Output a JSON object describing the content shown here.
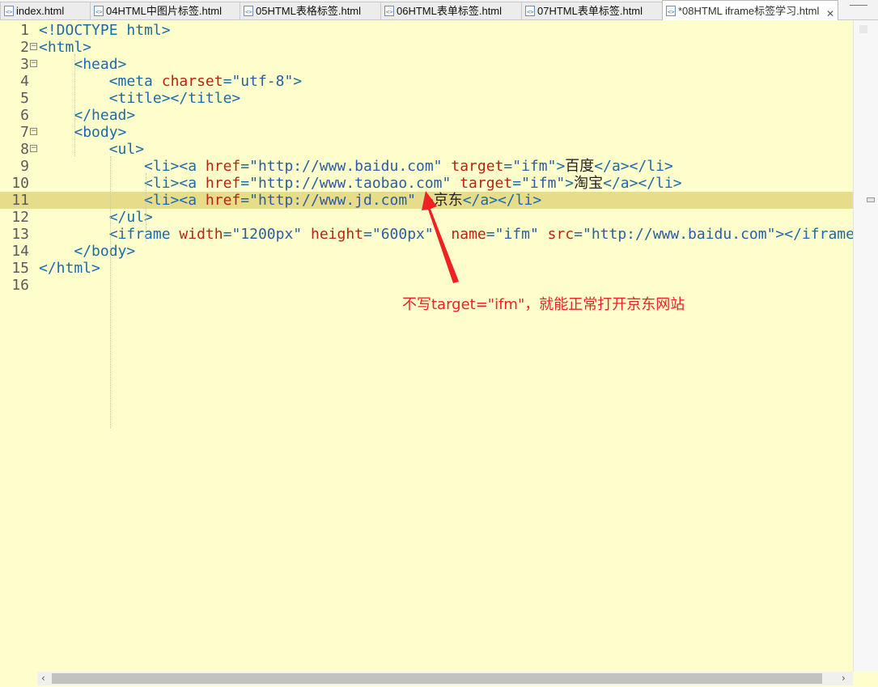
{
  "tabs": [
    {
      "label": "index.html",
      "active": false
    },
    {
      "label": "04HTML中图片标签.html",
      "active": false
    },
    {
      "label": "05HTML表格标签.html",
      "active": false
    },
    {
      "label": "06HTML表单标签.html",
      "active": false
    },
    {
      "label": "07HTML表单标签.html",
      "active": false
    },
    {
      "label": "*08HTML iframe标签学习.html",
      "active": true
    }
  ],
  "tab_close": "✕",
  "minimize": "—",
  "editor": {
    "current_line": "11",
    "lines": [
      {
        "num": "1",
        "fold": "",
        "segs": [
          [
            "tg",
            "<!DOCTYPE html>"
          ]
        ]
      },
      {
        "num": "2",
        "fold": "−",
        "segs": [
          [
            "tg",
            "<html>"
          ]
        ]
      },
      {
        "num": "3",
        "fold": "−",
        "segs": [
          [
            "tx",
            "    "
          ],
          [
            "tg",
            "<head>"
          ]
        ]
      },
      {
        "num": "4",
        "fold": "",
        "segs": [
          [
            "tx",
            "        "
          ],
          [
            "tg",
            "<meta "
          ],
          [
            "an",
            "charset"
          ],
          [
            "tg",
            "="
          ],
          [
            "av",
            "\"utf-8\""
          ],
          [
            "tg",
            ">"
          ]
        ]
      },
      {
        "num": "5",
        "fold": "",
        "segs": [
          [
            "tx",
            "        "
          ],
          [
            "tg",
            "<title></title>"
          ]
        ]
      },
      {
        "num": "6",
        "fold": "",
        "segs": [
          [
            "tx",
            "    "
          ],
          [
            "tg",
            "</head>"
          ]
        ]
      },
      {
        "num": "7",
        "fold": "−",
        "segs": [
          [
            "tx",
            "    "
          ],
          [
            "tg",
            "<body>"
          ]
        ]
      },
      {
        "num": "8",
        "fold": "−",
        "segs": [
          [
            "tx",
            "        "
          ],
          [
            "tg",
            "<ul>"
          ]
        ]
      },
      {
        "num": "9",
        "fold": "",
        "segs": [
          [
            "tx",
            "            "
          ],
          [
            "tg",
            "<li><a "
          ],
          [
            "an",
            "href"
          ],
          [
            "tg",
            "="
          ],
          [
            "av",
            "\"http://www.baidu.com\""
          ],
          [
            "tx",
            " "
          ],
          [
            "an",
            "target"
          ],
          [
            "tg",
            "="
          ],
          [
            "av",
            "\"ifm\""
          ],
          [
            "tg",
            ">"
          ],
          [
            "tx",
            "百度"
          ],
          [
            "tg",
            "</a></li>"
          ]
        ]
      },
      {
        "num": "10",
        "fold": "",
        "segs": [
          [
            "tx",
            "            "
          ],
          [
            "tg",
            "<li><a "
          ],
          [
            "an",
            "href"
          ],
          [
            "tg",
            "="
          ],
          [
            "av",
            "\"http://www.taobao.com\""
          ],
          [
            "tx",
            " "
          ],
          [
            "an",
            "target"
          ],
          [
            "tg",
            "="
          ],
          [
            "av",
            "\"ifm\""
          ],
          [
            "tg",
            ">"
          ],
          [
            "tx",
            "淘宝"
          ],
          [
            "tg",
            "</a></li>"
          ]
        ]
      },
      {
        "num": "11",
        "fold": "",
        "segs": [
          [
            "tx",
            "            "
          ],
          [
            "tg",
            "<li><a "
          ],
          [
            "an",
            "href"
          ],
          [
            "tg",
            "="
          ],
          [
            "av",
            "\"http://www.jd.com\""
          ],
          [
            "tx",
            " "
          ],
          [
            "tg",
            ">"
          ],
          [
            "tx",
            "京东"
          ],
          [
            "tg",
            "</a></li>"
          ]
        ]
      },
      {
        "num": "12",
        "fold": "",
        "segs": [
          [
            "tx",
            "        "
          ],
          [
            "tg",
            "</ul>"
          ]
        ]
      },
      {
        "num": "13",
        "fold": "",
        "segs": [
          [
            "tx",
            "        "
          ],
          [
            "tg",
            "<iframe "
          ],
          [
            "an",
            "width"
          ],
          [
            "tg",
            "="
          ],
          [
            "av",
            "\"1200px\""
          ],
          [
            "tx",
            " "
          ],
          [
            "an",
            "height"
          ],
          [
            "tg",
            "="
          ],
          [
            "av",
            "\"600px\""
          ],
          [
            "tx",
            "  "
          ],
          [
            "an",
            "name"
          ],
          [
            "tg",
            "="
          ],
          [
            "av",
            "\"ifm\""
          ],
          [
            "tx",
            " "
          ],
          [
            "an",
            "src"
          ],
          [
            "tg",
            "="
          ],
          [
            "av",
            "\"http://www.baidu.com\""
          ],
          [
            "tg",
            "></iframe>"
          ]
        ]
      },
      {
        "num": "14",
        "fold": "",
        "segs": [
          [
            "tx",
            "    "
          ],
          [
            "tg",
            "</body>"
          ]
        ]
      },
      {
        "num": "15",
        "fold": "",
        "segs": [
          [
            "tg",
            "</html>"
          ]
        ]
      },
      {
        "num": "16",
        "fold": "",
        "segs": []
      }
    ]
  },
  "annotation": {
    "text": "不写target=\"ifm\"，就能正常打开京东网站",
    "color": "#ee2222"
  },
  "colors": {
    "background": "#fefecd",
    "current_line": "#e6dc8a",
    "tag": "#1d6aa8",
    "attr_name": "#b5260f",
    "attr_value": "#2a5ea0"
  },
  "scroll_left": "‹",
  "scroll_right": "›"
}
